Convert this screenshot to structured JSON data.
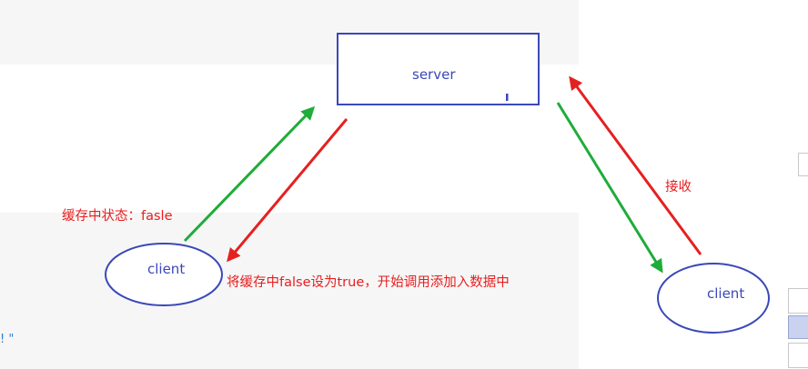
{
  "diagram": {
    "server_label": "server",
    "client_left_label": "client",
    "client_right_label": "client",
    "cache_state_label": "缓存中状态：fasle",
    "set_true_label": "将缓存中false设为true，开始调用添加入数据中",
    "receive_label": "接收",
    "edge_fragment": "! \""
  },
  "colors": {
    "node_stroke": "#3a48b8",
    "arrow_green": "#1fac3a",
    "arrow_red": "#e52020",
    "annotation_red": "#e81e1e"
  }
}
